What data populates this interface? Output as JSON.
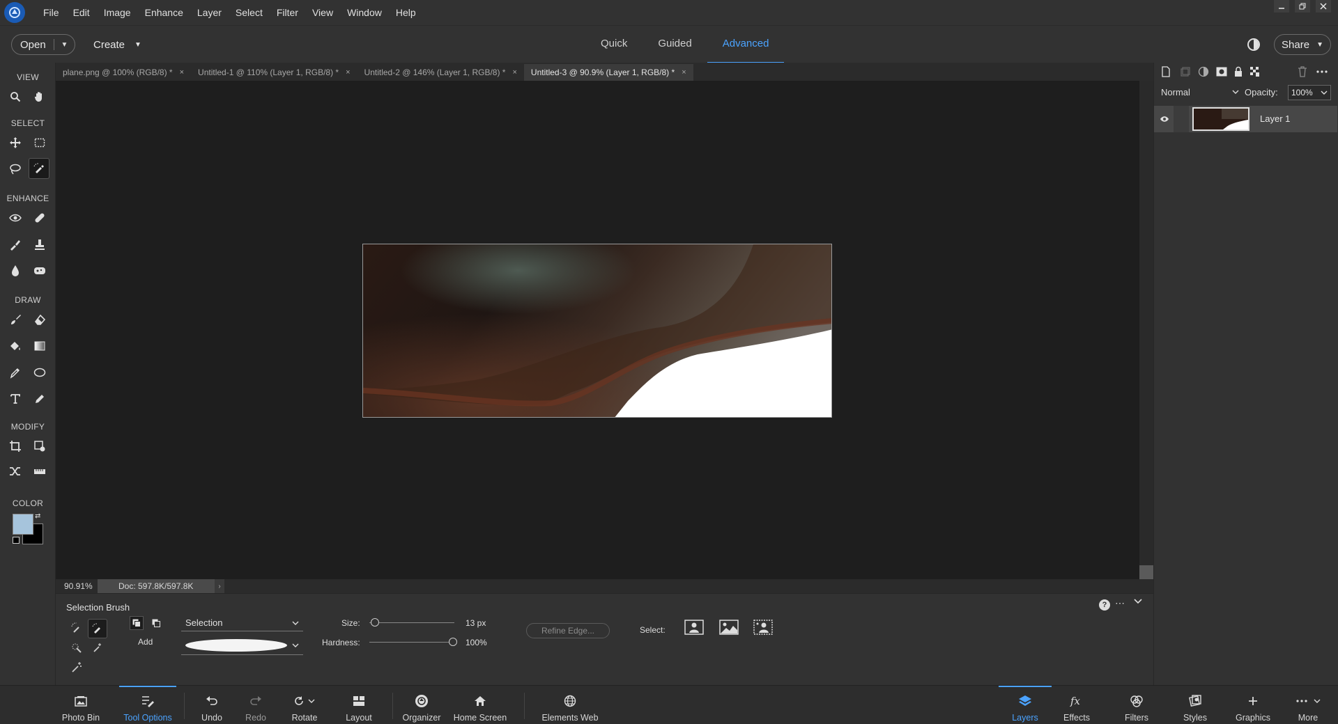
{
  "menubar": {
    "items": [
      "File",
      "Edit",
      "Image",
      "Enhance",
      "Layer",
      "Select",
      "Filter",
      "View",
      "Window",
      "Help"
    ]
  },
  "modebar": {
    "open_label": "Open",
    "create_label": "Create",
    "tabs": [
      "Quick",
      "Guided",
      "Advanced"
    ],
    "active_tab": "Advanced",
    "share_label": "Share"
  },
  "toolbox": {
    "sections": {
      "view": "VIEW",
      "select": "SELECT",
      "enhance": "ENHANCE",
      "draw": "DRAW",
      "modify": "MODIFY",
      "color": "COLOR"
    },
    "foreground_color": "#a6c4dc",
    "background_color": "#000000"
  },
  "doc_tabs": [
    {
      "title": "plane.png @ 100% (RGB/8) *",
      "close": "×"
    },
    {
      "title": "Untitled-1 @ 110% (Layer 1, RGB/8) *",
      "close": "×"
    },
    {
      "title": "Untitled-2 @ 146% (Layer 1, RGB/8) *",
      "close": "×"
    },
    {
      "title": "Untitled-3 @ 90.9% (Layer 1, RGB/8) *",
      "close": "×"
    }
  ],
  "statusbar": {
    "zoom": "90.91%",
    "doc_size": "Doc: 597.8K/597.8K",
    "arrow": "›"
  },
  "layers_panel": {
    "blend_mode": "Normal",
    "opacity_label": "Opacity:",
    "opacity_value": "100%",
    "layers": [
      {
        "name": "Layer 1",
        "visible": true
      }
    ]
  },
  "tool_options": {
    "title": "Selection Brush",
    "add_label": "Add",
    "mode_value": "Selection",
    "size_label": "Size:",
    "size_value": "13 px",
    "hardness_label": "Hardness:",
    "hardness_value": "100%",
    "refine_edge_label": "Refine Edge...",
    "select_label": "Select:",
    "help_glyph": "?"
  },
  "bottombar": {
    "items": [
      {
        "label": "Photo Bin",
        "icon": "photo-bin-icon"
      },
      {
        "label": "Tool Options",
        "icon": "tool-options-icon"
      },
      {
        "label": "Undo",
        "icon": "undo-icon"
      },
      {
        "label": "Redo",
        "icon": "redo-icon"
      },
      {
        "label": "Rotate",
        "icon": "rotate-icon"
      },
      {
        "label": "Layout",
        "icon": "layout-icon"
      },
      {
        "label": "Organizer",
        "icon": "organizer-icon"
      },
      {
        "label": "Home Screen",
        "icon": "home-icon"
      },
      {
        "label": "Elements Web",
        "icon": "globe-icon"
      },
      {
        "label": "Layers",
        "icon": "layers-icon"
      },
      {
        "label": "Effects",
        "icon": "fx-icon"
      },
      {
        "label": "Filters",
        "icon": "filters-icon"
      },
      {
        "label": "Styles",
        "icon": "styles-icon"
      },
      {
        "label": "Graphics",
        "icon": "plus-icon"
      },
      {
        "label": "More",
        "icon": "more-icon"
      }
    ],
    "active_left": "Tool Options",
    "active_right": "Layers"
  },
  "colors": {
    "accent": "#4ba3ff",
    "panel": "#323232",
    "canvas_bg": "#1e1e1e"
  }
}
